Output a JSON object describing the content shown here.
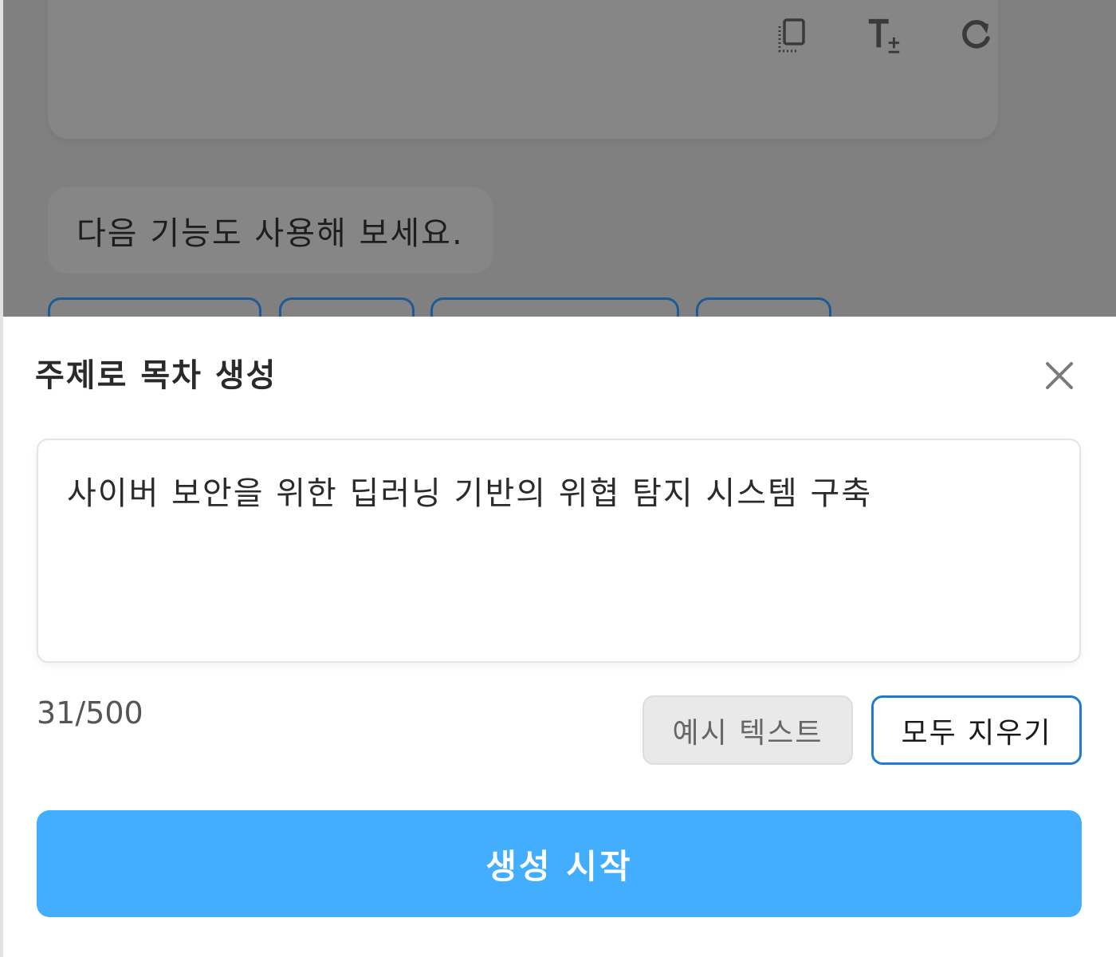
{
  "background": {
    "suggestion_text": "다음 기능도 사용해 보세요.",
    "card_tools": [
      {
        "icon": "copy-icon"
      },
      {
        "icon": "text-size-icon"
      },
      {
        "icon": "refresh-icon"
      }
    ]
  },
  "sheet": {
    "title": "주제로 목차 생성",
    "close_icon": "close-icon",
    "topic_value": "사이버 보안을 위한 딥러닝 기반의 위협 탐지 시스템 구축",
    "char_count": "31/500",
    "example_label": "예시 텍스트",
    "clear_label": "모두 지우기",
    "start_label": "생성 시작"
  },
  "colors": {
    "accent": "#42aefd",
    "outline_blue": "#1f7ad0",
    "overlay": "#808080"
  }
}
